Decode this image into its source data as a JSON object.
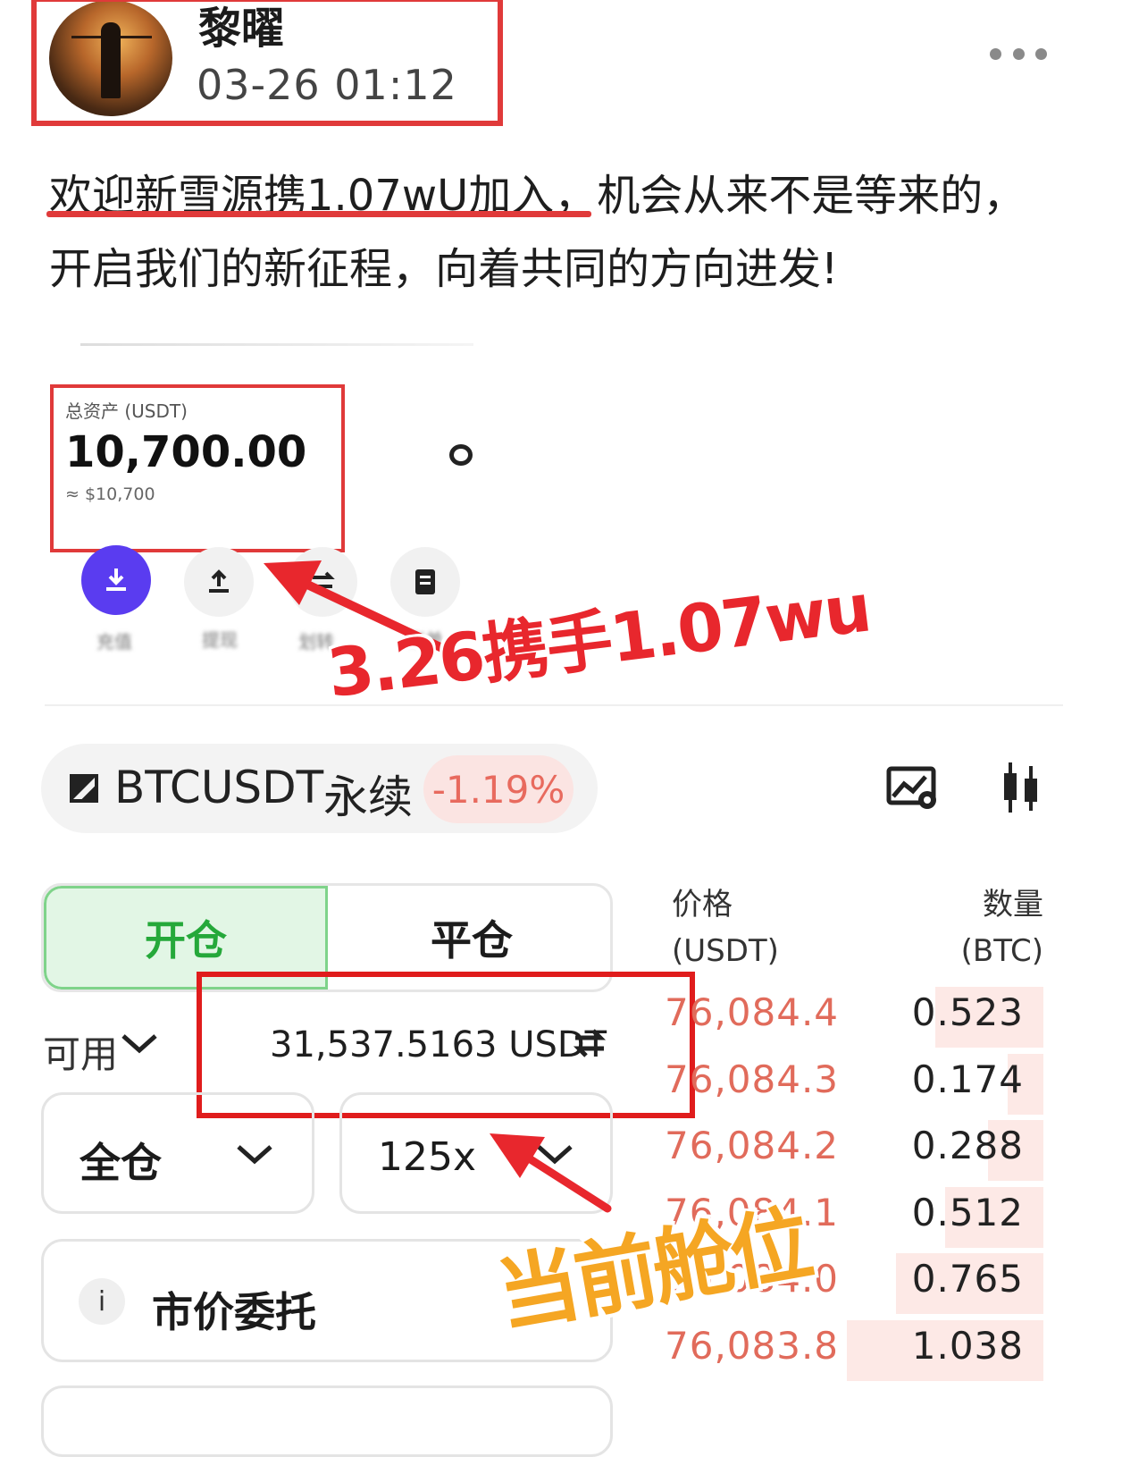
{
  "post": {
    "username": "黎曜",
    "timestamp": "03-26 01:12",
    "text": "欢迎新雪源携1.07wU加入，机会从来不是等来的，开启我们的新征程，向着共同的方向进发!"
  },
  "asset_card": {
    "label": "总资产 (USDT)",
    "value": "10,700.00",
    "approx": "≈ $10,700",
    "actions": [
      {
        "label": "充值",
        "icon": "download-icon"
      },
      {
        "label": "提现",
        "icon": "upload-icon"
      },
      {
        "label": "划转",
        "icon": "transfer-icon"
      },
      {
        "label": "账单",
        "icon": "receipt-icon"
      }
    ]
  },
  "annotations": {
    "date_note": "3.26携手1.07wu",
    "position_note": "当前舱位"
  },
  "trading": {
    "symbol": "BTCUSDT",
    "contract_type": "永续",
    "change": "-1.19%",
    "tab_open": "开仓",
    "tab_close": "平仓",
    "available_label": "可用",
    "available_value": "31,537.5163 USDT",
    "margin_mode": "全仓",
    "leverage": "125x",
    "order_type": "市价委托"
  },
  "order_book": {
    "price_header": "价格",
    "price_unit": "(USDT)",
    "qty_header": "数量",
    "qty_unit": "(BTC)",
    "rows": [
      {
        "price": "76,084.4",
        "qty": "0.523"
      },
      {
        "price": "76,084.3",
        "qty": "0.174"
      },
      {
        "price": "76,084.2",
        "qty": "0.288"
      },
      {
        "price": "76,084.1",
        "qty": "0.512"
      },
      {
        "price": "76,084.0",
        "qty": "0.765"
      },
      {
        "price": "76,083.8",
        "qty": "1.038"
      }
    ],
    "depth_fraction": [
      0.55,
      0.18,
      0.28,
      0.5,
      0.75,
      1.0
    ]
  },
  "colors": {
    "highlight_red": "#e03a3a",
    "price_red": "#e16b5b",
    "open_green": "#25a83a",
    "primary_purple": "#5a3cf0",
    "orange_annotation": "#f5a623"
  }
}
